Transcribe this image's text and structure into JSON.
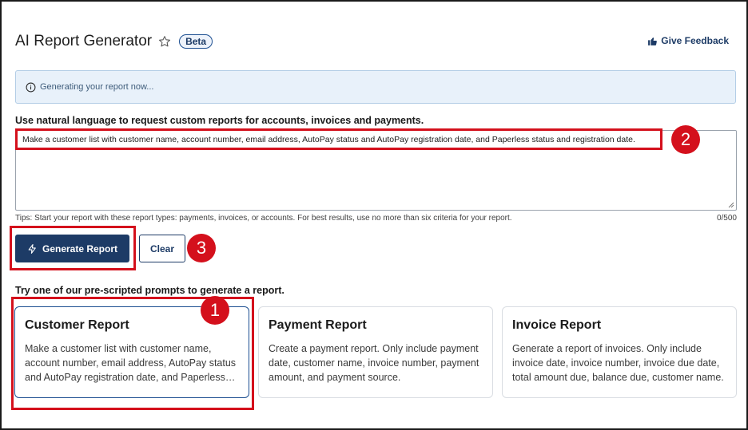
{
  "header": {
    "title": "AI Report Generator",
    "beta_label": "Beta",
    "feedback_label": "Give Feedback"
  },
  "alert": {
    "message": "Generating your report now..."
  },
  "prompt": {
    "label": "Use natural language to request custom reports for accounts, invoices and payments.",
    "value": "Make a customer list with customer name, account number, email address, AutoPay status and AutoPay registration date, and Paperless status and registration date.",
    "tips": "Tips: Start your report with these report types: payments, invoices, or accounts. For best results, use no more than six criteria for your report.",
    "counter": "0/500"
  },
  "actions": {
    "generate_label": "Generate Report",
    "clear_label": "Clear"
  },
  "prescripted": {
    "label": "Try one of our pre-scripted prompts to generate a report.",
    "cards": [
      {
        "title": "Customer Report",
        "description": "Make a customer list with customer name, account number, email address, AutoPay status and AutoPay registration date, and Paperless status and registration date."
      },
      {
        "title": "Payment Report",
        "description": "Create a payment report. Only include payment date, customer name, invoice number, payment amount, and payment source."
      },
      {
        "title": "Invoice Report",
        "description": "Generate a report of invoices. Only include invoice date, invoice number, invoice due date, total amount due, balance due, customer name."
      }
    ]
  },
  "annotations": {
    "badge_1": "1",
    "badge_2": "2",
    "badge_3": "3"
  },
  "colors": {
    "primary": "#1d3b66",
    "highlight": "#d4101c",
    "alert_bg": "#e8f1fa"
  }
}
